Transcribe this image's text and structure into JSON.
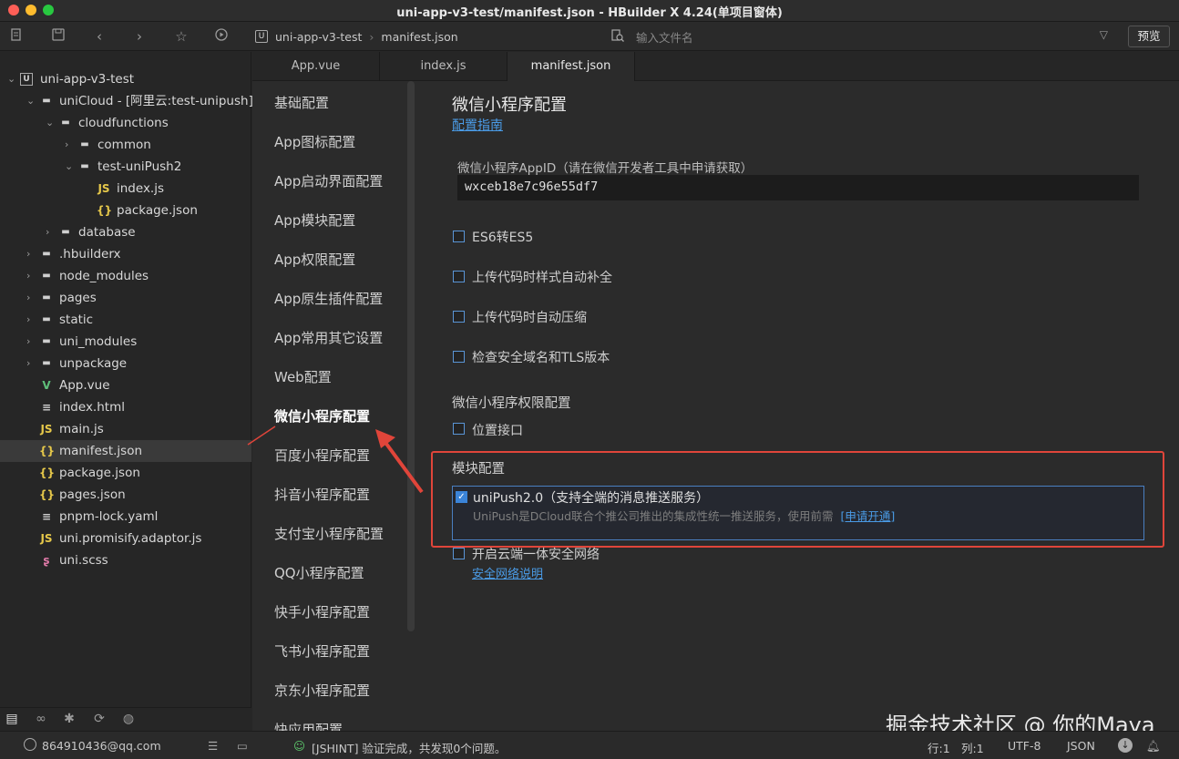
{
  "window": {
    "title": "uni-app-v3-test/manifest.json - HBuilder X 4.24(单项目窗体)"
  },
  "colors": {
    "accent": "#3b84d8",
    "highlight_border": "#e0453a",
    "link": "#4a9be6"
  },
  "toolbar": {
    "icons": [
      "new-file-icon",
      "save-icon",
      "back-icon",
      "forward-icon",
      "star-icon",
      "run-icon"
    ],
    "breadcrumb": {
      "project": "uni-app-v3-test",
      "file": "manifest.json"
    },
    "file_search_placeholder": "输入文件名",
    "preview_label": "预览"
  },
  "sidebar": {
    "items": [
      {
        "label": "uni-app-v3-test",
        "type": "project",
        "expanded": true
      },
      {
        "label": "uniCloud - [阿里云:test-unipush]",
        "type": "folder",
        "expanded": true
      },
      {
        "label": "cloudfunctions",
        "type": "folder",
        "expanded": true
      },
      {
        "label": "common",
        "type": "folder",
        "expanded": false
      },
      {
        "label": "test-uniPush2",
        "type": "folder",
        "expanded": true
      },
      {
        "label": "index.js",
        "type": "js"
      },
      {
        "label": "package.json",
        "type": "json"
      },
      {
        "label": "database",
        "type": "folder",
        "expanded": false
      },
      {
        "label": ".hbuilderx",
        "type": "folder",
        "expanded": false
      },
      {
        "label": "node_modules",
        "type": "folder",
        "expanded": false
      },
      {
        "label": "pages",
        "type": "folder",
        "expanded": false
      },
      {
        "label": "static",
        "type": "folder",
        "expanded": false
      },
      {
        "label": "uni_modules",
        "type": "folder",
        "expanded": false
      },
      {
        "label": "unpackage",
        "type": "folder",
        "expanded": false
      },
      {
        "label": "App.vue",
        "type": "vue"
      },
      {
        "label": "index.html",
        "type": "html"
      },
      {
        "label": "main.js",
        "type": "js"
      },
      {
        "label": "manifest.json",
        "type": "json",
        "selected": true
      },
      {
        "label": "package.json",
        "type": "json"
      },
      {
        "label": "pages.json",
        "type": "json"
      },
      {
        "label": "pnpm-lock.yaml",
        "type": "yaml"
      },
      {
        "label": "uni.promisify.adaptor.js",
        "type": "js"
      },
      {
        "label": "uni.scss",
        "type": "scss"
      }
    ],
    "bottom_icons": [
      "explorer-icon",
      "binoculars-icon",
      "bug-icon",
      "git-icon",
      "globe-icon"
    ]
  },
  "tabs": [
    {
      "label": "App.vue",
      "active": false
    },
    {
      "label": "index.js",
      "active": false
    },
    {
      "label": "manifest.json",
      "active": true
    }
  ],
  "nav": {
    "items": [
      "基础配置",
      "App图标配置",
      "App启动界面配置",
      "App模块配置",
      "App权限配置",
      "App原生插件配置",
      "App常用其它设置",
      "Web配置",
      "微信小程序配置",
      "百度小程序配置",
      "抖音小程序配置",
      "支付宝小程序配置",
      "QQ小程序配置",
      "快手小程序配置",
      "飞书小程序配置",
      "京东小程序配置",
      "快应用配置"
    ],
    "active_index": 8
  },
  "content": {
    "heading": "微信小程序配置",
    "guide_link": "配置指南",
    "appid_label": "微信小程序AppID（请在微信开发者工具中申请获取）",
    "appid_value": "wxceb18e7c96e55df7",
    "options": [
      {
        "label": "ES6转ES5",
        "checked": false
      },
      {
        "label": "上传代码时样式自动补全",
        "checked": false
      },
      {
        "label": "上传代码时自动压缩",
        "checked": false
      },
      {
        "label": "检查安全域名和TLS版本",
        "checked": false
      }
    ],
    "permission_section": "微信小程序权限配置",
    "permission_location": "位置接口",
    "module_section": "模块配置",
    "unipush_title": "uniPush2.0（支持全端的消息推送服务）",
    "unipush_desc": "UniPush是DCloud联合个推公司推出的集成性统一推送服务，使用前需",
    "unipush_apply": "[申请开通]",
    "unipush_checked": true,
    "secure_network": "开启云端一体安全网络",
    "secure_network_link": "安全网络说明"
  },
  "statusbar": {
    "account": "864910436@qq.com",
    "message": "[JSHINT] 验证完成，共发现0个问题。",
    "line": "行:1",
    "column": "列:1",
    "encoding": "UTF-8",
    "language": "JSON"
  },
  "watermark": "掘金技术社区 @ 你的Maya"
}
